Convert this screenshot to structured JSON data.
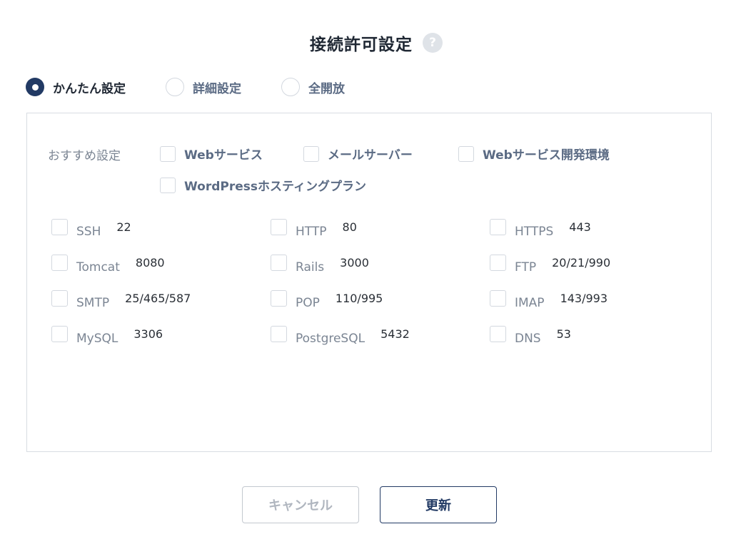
{
  "dialog": {
    "title": "接続許可設定",
    "help_icon": "question-mark-icon",
    "help_glyph": "?"
  },
  "modes": [
    {
      "label": "かんたん設定",
      "selected": true
    },
    {
      "label": "詳細設定",
      "selected": false
    },
    {
      "label": "全開放",
      "selected": false
    }
  ],
  "presets": {
    "label": "おすすめ設定",
    "items": [
      {
        "label": "Webサービス",
        "checked": false
      },
      {
        "label": "メールサーバー",
        "checked": false
      },
      {
        "label": "Webサービス開発環境",
        "checked": false
      },
      {
        "label": "WordPressホスティングプラン",
        "checked": false
      }
    ]
  },
  "ports": [
    {
      "name": "SSH",
      "port": "22",
      "checked": false
    },
    {
      "name": "HTTP",
      "port": "80",
      "checked": false
    },
    {
      "name": "HTTPS",
      "port": "443",
      "checked": false
    },
    {
      "name": "Tomcat",
      "port": "8080",
      "checked": false
    },
    {
      "name": "Rails",
      "port": "3000",
      "checked": false
    },
    {
      "name": "FTP",
      "port": "20/21/990",
      "checked": false
    },
    {
      "name": "SMTP",
      "port": "25/465/587",
      "checked": false
    },
    {
      "name": "POP",
      "port": "110/995",
      "checked": false
    },
    {
      "name": "IMAP",
      "port": "143/993",
      "checked": false
    },
    {
      "name": "MySQL",
      "port": "3306",
      "checked": false
    },
    {
      "name": "PostgreSQL",
      "port": "5432",
      "checked": false
    },
    {
      "name": "DNS",
      "port": "53",
      "checked": false
    }
  ],
  "buttons": {
    "cancel_label": "キャンセル",
    "update_label": "更新"
  },
  "colors": {
    "accent": "#223a64",
    "border": "#d8dce2",
    "muted_text": "#7b8593"
  }
}
